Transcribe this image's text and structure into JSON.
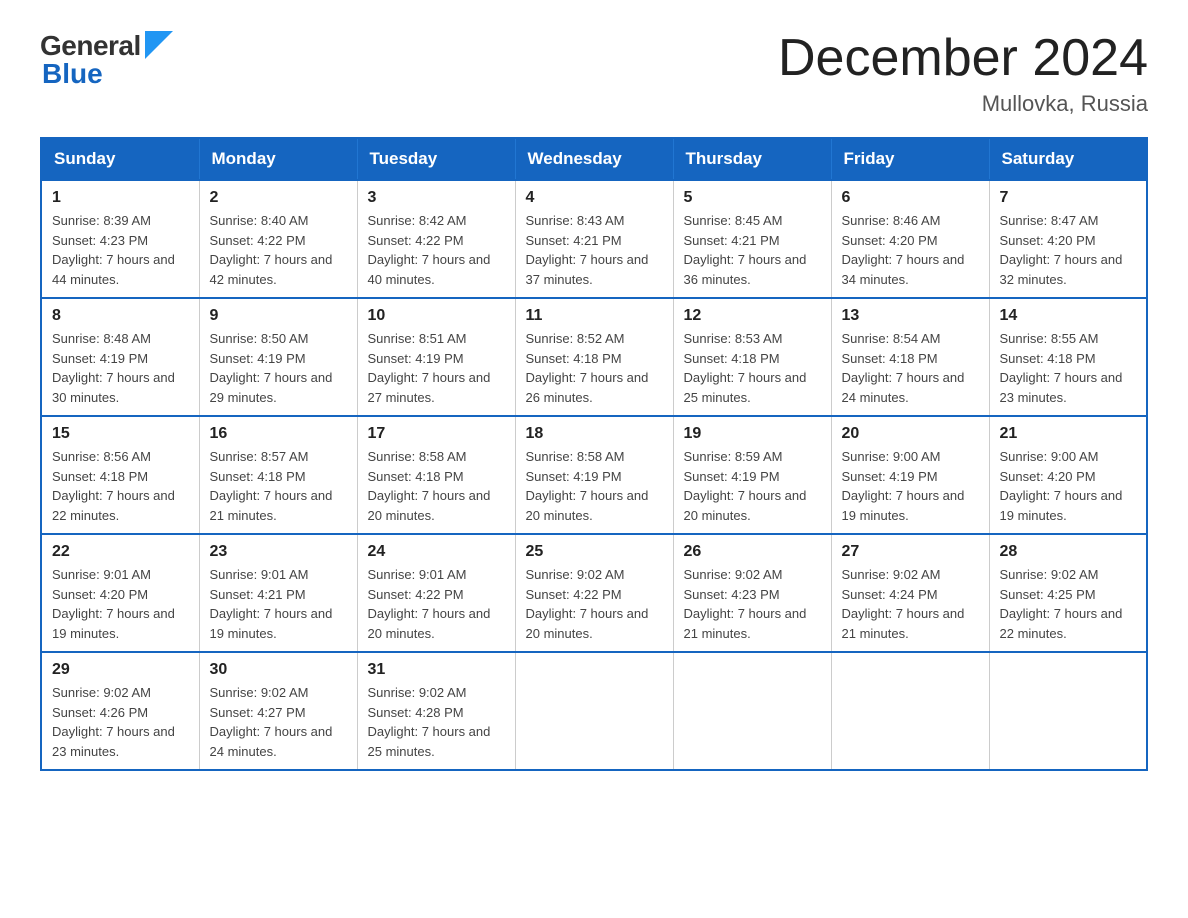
{
  "header": {
    "logo_general": "General",
    "logo_blue": "Blue",
    "month_title": "December 2024",
    "location": "Mullovka, Russia"
  },
  "days_of_week": [
    "Sunday",
    "Monday",
    "Tuesday",
    "Wednesday",
    "Thursday",
    "Friday",
    "Saturday"
  ],
  "weeks": [
    [
      {
        "num": "1",
        "sunrise": "8:39 AM",
        "sunset": "4:23 PM",
        "daylight": "7 hours and 44 minutes."
      },
      {
        "num": "2",
        "sunrise": "8:40 AM",
        "sunset": "4:22 PM",
        "daylight": "7 hours and 42 minutes."
      },
      {
        "num": "3",
        "sunrise": "8:42 AM",
        "sunset": "4:22 PM",
        "daylight": "7 hours and 40 minutes."
      },
      {
        "num": "4",
        "sunrise": "8:43 AM",
        "sunset": "4:21 PM",
        "daylight": "7 hours and 37 minutes."
      },
      {
        "num": "5",
        "sunrise": "8:45 AM",
        "sunset": "4:21 PM",
        "daylight": "7 hours and 36 minutes."
      },
      {
        "num": "6",
        "sunrise": "8:46 AM",
        "sunset": "4:20 PM",
        "daylight": "7 hours and 34 minutes."
      },
      {
        "num": "7",
        "sunrise": "8:47 AM",
        "sunset": "4:20 PM",
        "daylight": "7 hours and 32 minutes."
      }
    ],
    [
      {
        "num": "8",
        "sunrise": "8:48 AM",
        "sunset": "4:19 PM",
        "daylight": "7 hours and 30 minutes."
      },
      {
        "num": "9",
        "sunrise": "8:50 AM",
        "sunset": "4:19 PM",
        "daylight": "7 hours and 29 minutes."
      },
      {
        "num": "10",
        "sunrise": "8:51 AM",
        "sunset": "4:19 PM",
        "daylight": "7 hours and 27 minutes."
      },
      {
        "num": "11",
        "sunrise": "8:52 AM",
        "sunset": "4:18 PM",
        "daylight": "7 hours and 26 minutes."
      },
      {
        "num": "12",
        "sunrise": "8:53 AM",
        "sunset": "4:18 PM",
        "daylight": "7 hours and 25 minutes."
      },
      {
        "num": "13",
        "sunrise": "8:54 AM",
        "sunset": "4:18 PM",
        "daylight": "7 hours and 24 minutes."
      },
      {
        "num": "14",
        "sunrise": "8:55 AM",
        "sunset": "4:18 PM",
        "daylight": "7 hours and 23 minutes."
      }
    ],
    [
      {
        "num": "15",
        "sunrise": "8:56 AM",
        "sunset": "4:18 PM",
        "daylight": "7 hours and 22 minutes."
      },
      {
        "num": "16",
        "sunrise": "8:57 AM",
        "sunset": "4:18 PM",
        "daylight": "7 hours and 21 minutes."
      },
      {
        "num": "17",
        "sunrise": "8:58 AM",
        "sunset": "4:18 PM",
        "daylight": "7 hours and 20 minutes."
      },
      {
        "num": "18",
        "sunrise": "8:58 AM",
        "sunset": "4:19 PM",
        "daylight": "7 hours and 20 minutes."
      },
      {
        "num": "19",
        "sunrise": "8:59 AM",
        "sunset": "4:19 PM",
        "daylight": "7 hours and 20 minutes."
      },
      {
        "num": "20",
        "sunrise": "9:00 AM",
        "sunset": "4:19 PM",
        "daylight": "7 hours and 19 minutes."
      },
      {
        "num": "21",
        "sunrise": "9:00 AM",
        "sunset": "4:20 PM",
        "daylight": "7 hours and 19 minutes."
      }
    ],
    [
      {
        "num": "22",
        "sunrise": "9:01 AM",
        "sunset": "4:20 PM",
        "daylight": "7 hours and 19 minutes."
      },
      {
        "num": "23",
        "sunrise": "9:01 AM",
        "sunset": "4:21 PM",
        "daylight": "7 hours and 19 minutes."
      },
      {
        "num": "24",
        "sunrise": "9:01 AM",
        "sunset": "4:22 PM",
        "daylight": "7 hours and 20 minutes."
      },
      {
        "num": "25",
        "sunrise": "9:02 AM",
        "sunset": "4:22 PM",
        "daylight": "7 hours and 20 minutes."
      },
      {
        "num": "26",
        "sunrise": "9:02 AM",
        "sunset": "4:23 PM",
        "daylight": "7 hours and 21 minutes."
      },
      {
        "num": "27",
        "sunrise": "9:02 AM",
        "sunset": "4:24 PM",
        "daylight": "7 hours and 21 minutes."
      },
      {
        "num": "28",
        "sunrise": "9:02 AM",
        "sunset": "4:25 PM",
        "daylight": "7 hours and 22 minutes."
      }
    ],
    [
      {
        "num": "29",
        "sunrise": "9:02 AM",
        "sunset": "4:26 PM",
        "daylight": "7 hours and 23 minutes."
      },
      {
        "num": "30",
        "sunrise": "9:02 AM",
        "sunset": "4:27 PM",
        "daylight": "7 hours and 24 minutes."
      },
      {
        "num": "31",
        "sunrise": "9:02 AM",
        "sunset": "4:28 PM",
        "daylight": "7 hours and 25 minutes."
      },
      null,
      null,
      null,
      null
    ]
  ],
  "labels": {
    "sunrise": "Sunrise:",
    "sunset": "Sunset:",
    "daylight": "Daylight:"
  }
}
